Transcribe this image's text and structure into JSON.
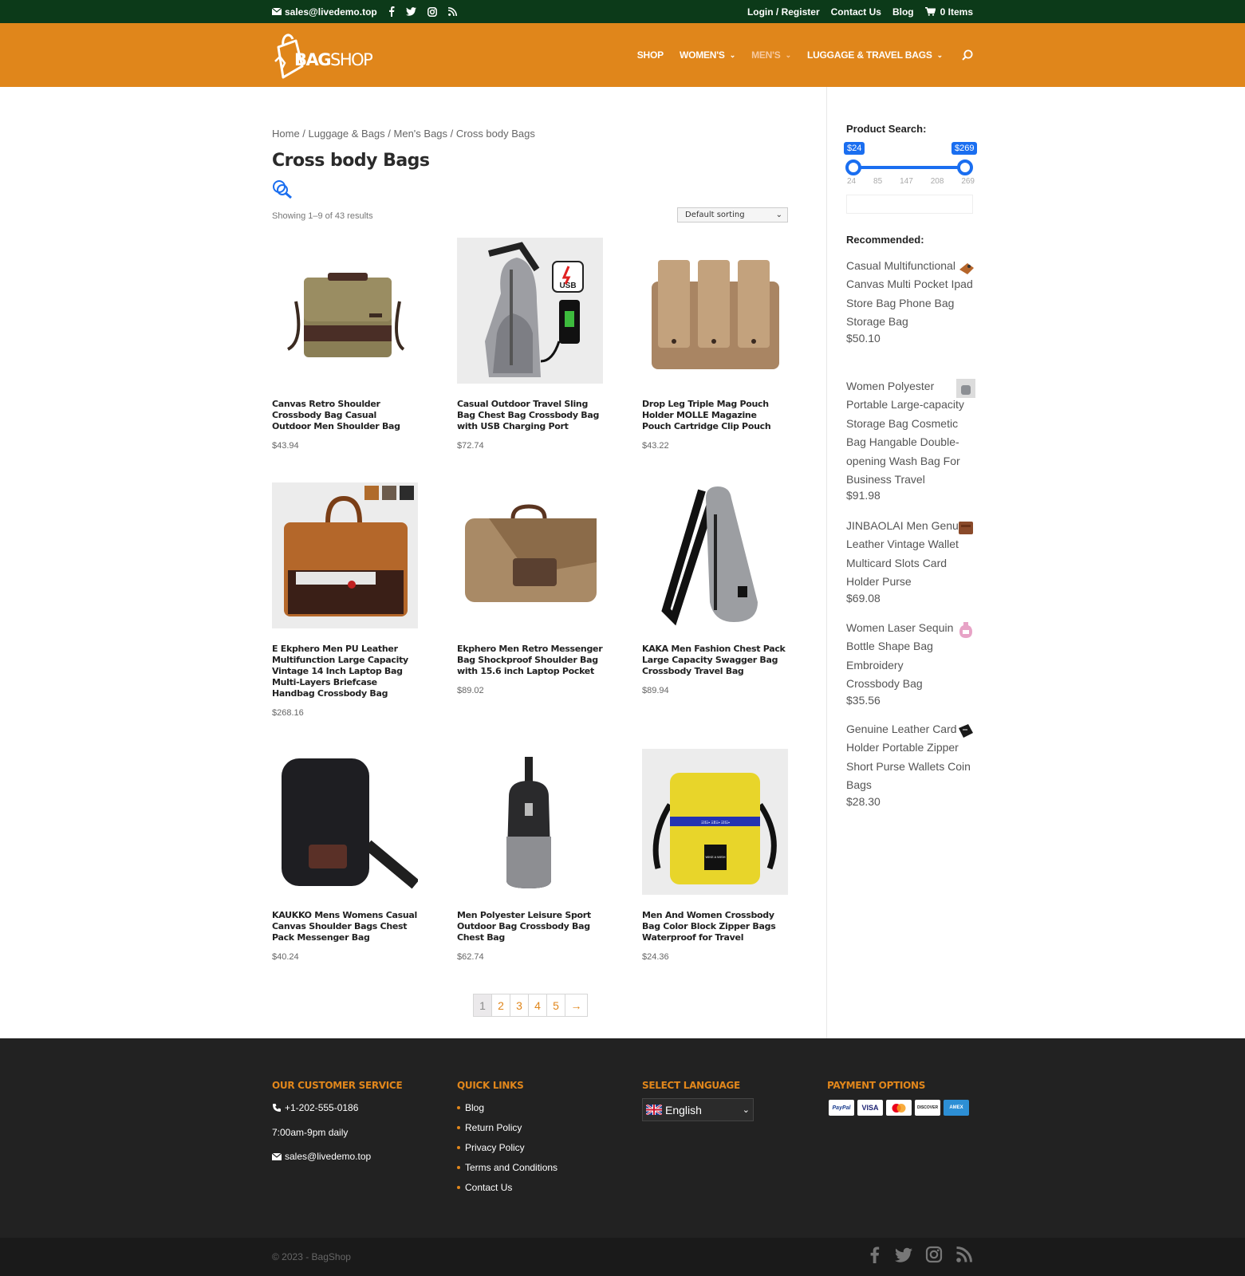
{
  "topbar": {
    "email": "sales@livedemo.top",
    "login": "Login / Register",
    "contact": "Contact Us",
    "blog": "Blog",
    "cart": "0 Items"
  },
  "header": {
    "logo_text_1": "BAG",
    "logo_text_2": "SHOP",
    "nav": [
      {
        "label": "SHOP"
      },
      {
        "label": "WOMEN'S"
      },
      {
        "label": "MEN'S"
      },
      {
        "label": "LUGGAGE & TRAVEL BAGS"
      }
    ]
  },
  "breadcrumb": {
    "home": "Home",
    "sep": " / ",
    "c1": "Luggage & Bags",
    "c2": "Men's Bags",
    "current": "Cross body Bags"
  },
  "page_title": "Cross body Bags",
  "result_count": "Showing 1–9 of 43 results",
  "sorting": "Default sorting",
  "products": [
    {
      "name": "Canvas Retro Shoulder Crossbody Bag Casual Outdoor Men Shoulder Bag",
      "price": "$43.94"
    },
    {
      "name": "Casual Outdoor Travel Sling Bag Chest Bag Crossbody Bag with USB Charging Port",
      "price": "$72.74"
    },
    {
      "name": "Drop Leg Triple Mag Pouch Holder MOLLE Magazine Pouch Cartridge Clip Pouch",
      "price": "$43.22"
    },
    {
      "name": "E Ekphero Men PU Leather Multifunction Large Capacity Vintage 14 Inch Laptop Bag Multi-Layers Briefcase Handbag Crossbody Bag",
      "price": "$268.16"
    },
    {
      "name": "Ekphero Men Retro Messenger Bag Shockproof Shoulder Bag with 15.6 inch Laptop Pocket",
      "price": "$89.02"
    },
    {
      "name": "KAKA Men Fashion Chest Pack Large Capacity Swagger Bag Crossbody Travel Bag",
      "price": "$89.94"
    },
    {
      "name": "KAUKKO Mens Womens Casual Canvas Shoulder Bags Chest Pack Messenger Bag",
      "price": "$40.24"
    },
    {
      "name": "Men Polyester Leisure Sport Outdoor Bag Crossbody Bag Chest Bag",
      "price": "$62.74"
    },
    {
      "name": "Men And Women Crossbody Bag Color Block Zipper Bags Waterproof for Travel",
      "price": "$24.36"
    }
  ],
  "product_images": {
    "usb_label": "USB",
    "yellow_strip": "ΞΙΙΞ▪ ΞΙΙΞ▪ ΞΙΙΞ▪",
    "yellow_patch": "WIKE A WISH"
  },
  "pagination": [
    "1",
    "2",
    "3",
    "4",
    "5",
    "→"
  ],
  "sidebar": {
    "search_title": "Product Search:",
    "price_min": "$24",
    "price_max": "$269",
    "scale": [
      "24",
      "85",
      "147",
      "208",
      "269"
    ],
    "recommended_title": "Recommended:",
    "recommended": [
      {
        "name": "Casual Multifunctional Canvas Multi Pocket Ipad Store Bag Phone Bag Storage Bag",
        "price": "$50.10"
      },
      {
        "name": "Women Polyester Portable Large-capacity Storage Bag Cosmetic Bag Hangable Double-opening Wash Bag For Business Travel",
        "price": "$91.98"
      },
      {
        "name": "JINBAOLAI Men Genuine Leather Vintage Wallet Multicard Slots Card Holder Purse",
        "price": "$69.08"
      },
      {
        "name": "Women Laser Sequin Bottle Shape Bag Embroidery Crossbody Bag",
        "price": "$35.56"
      },
      {
        "name": "Genuine Leather Card Holder Portable Zipper Short Purse Wallets Coin Bags",
        "price": "$28.30"
      }
    ]
  },
  "footer": {
    "service_title": "OUR CUSTOMER SERVICE",
    "phone": "+1-202-555-0186",
    "hours": "7:00am-9pm daily",
    "email": "sales@livedemo.top",
    "links_title": "QUICK LINKS",
    "links": [
      "Blog",
      "Return Policy",
      "Privacy Policy",
      "Terms and Conditions",
      "Contact Us"
    ],
    "lang_title": "SELECT LANGUAGE",
    "language": "English",
    "pay_title": "PAYMENT OPTIONS",
    "payments": [
      "PayPal",
      "VISA",
      "MC",
      "DISCOVER",
      "AMEX"
    ],
    "copyright": "© 2023 - BagShop"
  },
  "colors": {
    "topbar": "#0c3a19",
    "header": "#e0861b",
    "accent": "#e0861b",
    "slider": "#1a6ef0",
    "footer": "#222222"
  },
  "icons": [
    "envelope-icon",
    "facebook-icon",
    "twitter-icon",
    "instagram-icon",
    "rss-icon",
    "cart-icon",
    "search-icon",
    "phone-icon",
    "uk-flag-icon"
  ]
}
